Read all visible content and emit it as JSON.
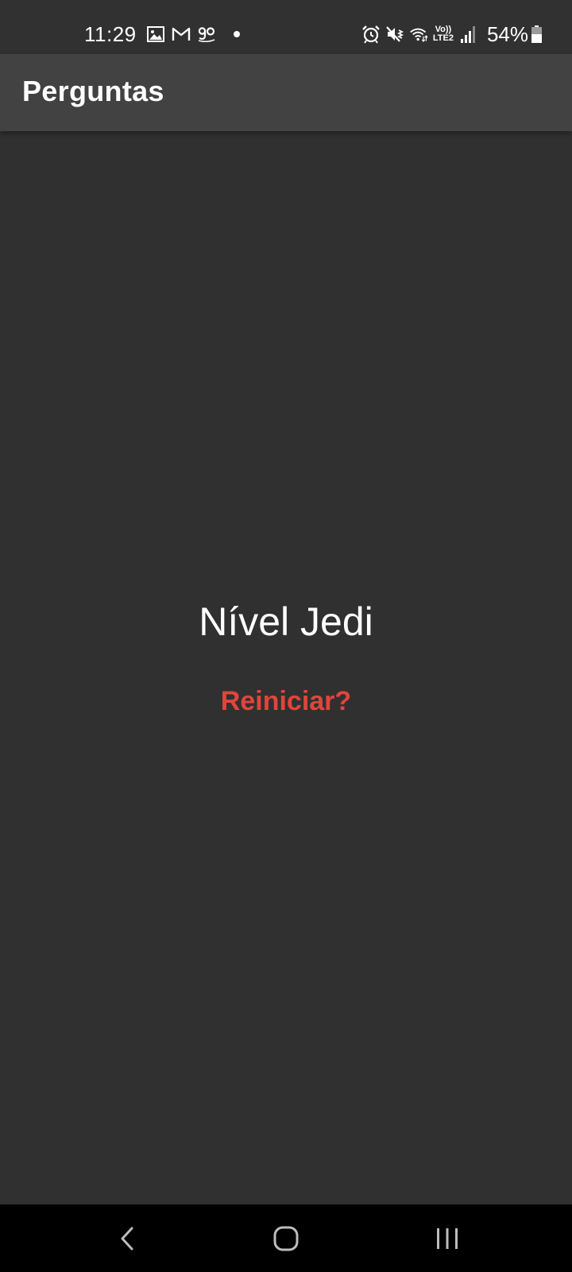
{
  "status_bar": {
    "time": "11:29",
    "left_icons": [
      "image-icon",
      "gmail-icon",
      "go-icon",
      "notification-dot"
    ],
    "right_icons": [
      "alarm-icon",
      "mute-vibrate-icon",
      "wifi-icon",
      "volte-lte-icon",
      "signal-icon"
    ],
    "lte_top": "Vo))",
    "lte_bottom": "LTE2",
    "battery_percent": "54%",
    "battery_level": 0.54
  },
  "app_bar": {
    "title": "Perguntas",
    "background": "#424242"
  },
  "main": {
    "result_text": "Nível Jedi",
    "restart_label": "Reiniciar?",
    "restart_color": "#e0453c",
    "background": "#303030"
  },
  "nav_bar": {
    "icons": [
      "back-icon",
      "home-icon",
      "recents-icon"
    ]
  }
}
